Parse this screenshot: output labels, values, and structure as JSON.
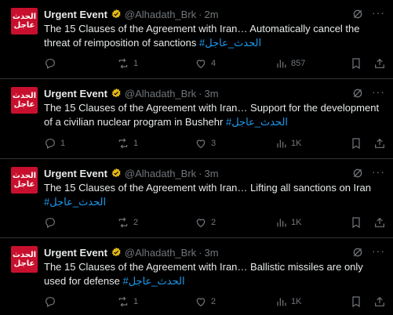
{
  "colors": {
    "background": "#000000",
    "text": "#e7e9ea",
    "muted": "#71767b",
    "link": "#1d9bf0",
    "avatar_bg": "#c8102e",
    "verified_badge": "#e2b719",
    "divider": "#2f3336"
  },
  "avatar_text": "الحدث\nعاجل",
  "tweets": [
    {
      "author": "Urgent Event",
      "handle": "@Alhadath_Brk",
      "separator": "·",
      "time": "2m",
      "text": "The 15 Clauses of the Agreement with Iran… Automatically cancel the threat of reimposition of sanctions ",
      "hashtag": "#الحدث_عاجل",
      "replies": "",
      "reposts": "1",
      "likes": "4",
      "views": "857"
    },
    {
      "author": "Urgent Event",
      "handle": "@Alhadath_Brk",
      "separator": "·",
      "time": "3m",
      "text": "The 15 Clauses of the Agreement with Iran… Support for the development of a civilian nuclear program in Bushehr ",
      "hashtag": "#الحدث_عاجل",
      "replies": "1",
      "reposts": "1",
      "likes": "3",
      "views": "1K"
    },
    {
      "author": "Urgent Event",
      "handle": "@Alhadath_Brk",
      "separator": "·",
      "time": "3m",
      "text": "The 15 Clauses of the Agreement with Iran… Lifting all sanctions on Iran ",
      "hashtag": "#الحدث_عاجل",
      "replies": "",
      "reposts": "2",
      "likes": "2",
      "views": "1K"
    },
    {
      "author": "Urgent Event",
      "handle": "@Alhadath_Brk",
      "separator": "·",
      "time": "3m",
      "text": "The 15 Clauses of the Agreement with Iran… Ballistic missiles are only used for defense ",
      "hashtag": "#الحدث_عاجل",
      "replies": "",
      "reposts": "1",
      "likes": "2",
      "views": "1K"
    }
  ],
  "icons": {
    "verified": "verified-badge-icon",
    "grok": "grok-icon",
    "more": "more-icon",
    "reply": "reply-icon",
    "repost": "repost-icon",
    "like": "like-icon",
    "views": "views-icon",
    "bookmark": "bookmark-icon",
    "share": "share-icon"
  }
}
